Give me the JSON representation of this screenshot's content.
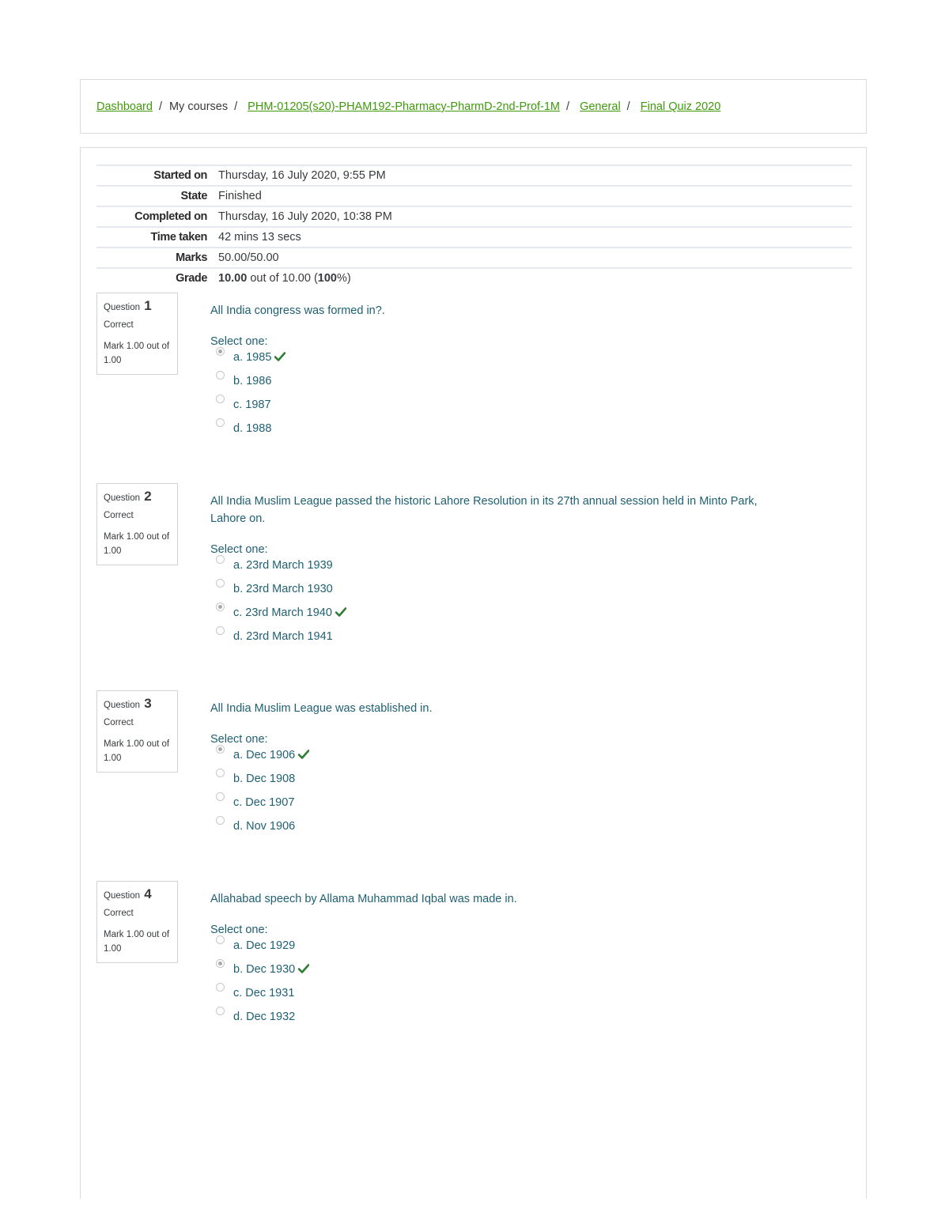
{
  "breadcrumb": [
    {
      "label": "Dashboard",
      "link": true
    },
    {
      "label": "My courses",
      "link": false
    },
    {
      "label": "PHM-01205(s20)-PHAM192-Pharmacy-PharmD-2nd-Prof-1M",
      "link": true
    },
    {
      "label": "General",
      "link": true
    },
    {
      "label": "Final Quiz 2020",
      "link": true
    }
  ],
  "breadcrumb_separator": "/",
  "summary": {
    "started_on": {
      "label": "Started on",
      "value": "Thursday, 16 July 2020, 9:55 PM"
    },
    "state": {
      "label": "State",
      "value": "Finished"
    },
    "completed_on": {
      "label": "Completed on",
      "value": "Thursday, 16 July 2020, 10:38 PM"
    },
    "time_taken": {
      "label": "Time taken",
      "value": "42 mins 13 secs"
    },
    "marks": {
      "label": "Marks",
      "value": "50.00/50.00"
    },
    "grade": {
      "label": "Grade",
      "score": "10.00",
      "mid": " out of 10.00 (",
      "percent": "100",
      "end": "%)"
    }
  },
  "colors": {
    "link": "#3e9a0a",
    "question_text": "#1f6073",
    "check": "#2e7d32"
  },
  "questions": [
    {
      "label": "Question",
      "number": "1",
      "state": "Correct",
      "grade": "Mark 1.00 out of 1.00",
      "text": "All India congress was formed in?.",
      "prompt": "Select one:",
      "options": [
        {
          "label": "a. 1985",
          "selected": true,
          "correct": true
        },
        {
          "label": "b. 1986",
          "selected": false,
          "correct": false
        },
        {
          "label": "c. 1987",
          "selected": false,
          "correct": false
        },
        {
          "label": "d. 1988",
          "selected": false,
          "correct": false
        }
      ]
    },
    {
      "label": "Question",
      "number": "2",
      "state": "Correct",
      "grade": "Mark 1.00 out of 1.00",
      "text": "All India Muslim League passed the historic Lahore Resolution in its 27th annual session held in Minto Park, Lahore on.",
      "prompt": "Select one:",
      "options": [
        {
          "label": "a. 23rd March 1939",
          "selected": false,
          "correct": false
        },
        {
          "label": "b. 23rd March 1930",
          "selected": false,
          "correct": false
        },
        {
          "label": "c. 23rd March 1940",
          "selected": true,
          "correct": true
        },
        {
          "label": "d. 23rd March 1941",
          "selected": false,
          "correct": false
        }
      ]
    },
    {
      "label": "Question",
      "number": "3",
      "state": "Correct",
      "grade": "Mark 1.00 out of 1.00",
      "text": "All India Muslim League was established in.",
      "prompt": "Select one:",
      "options": [
        {
          "label": "a. Dec 1906",
          "selected": true,
          "correct": true
        },
        {
          "label": "b. Dec 1908",
          "selected": false,
          "correct": false
        },
        {
          "label": "c. Dec 1907",
          "selected": false,
          "correct": false
        },
        {
          "label": "d. Nov 1906",
          "selected": false,
          "correct": false
        }
      ]
    },
    {
      "label": "Question",
      "number": "4",
      "state": "Correct",
      "grade": "Mark 1.00 out of 1.00",
      "text": "Allahabad speech by Allama Muhammad Iqbal was made in.",
      "prompt": "Select one:",
      "options": [
        {
          "label": "a. Dec 1929",
          "selected": false,
          "correct": false
        },
        {
          "label": "b. Dec 1930",
          "selected": true,
          "correct": true
        },
        {
          "label": "c. Dec 1931",
          "selected": false,
          "correct": false
        },
        {
          "label": "d. Dec 1932",
          "selected": false,
          "correct": false
        }
      ]
    }
  ]
}
